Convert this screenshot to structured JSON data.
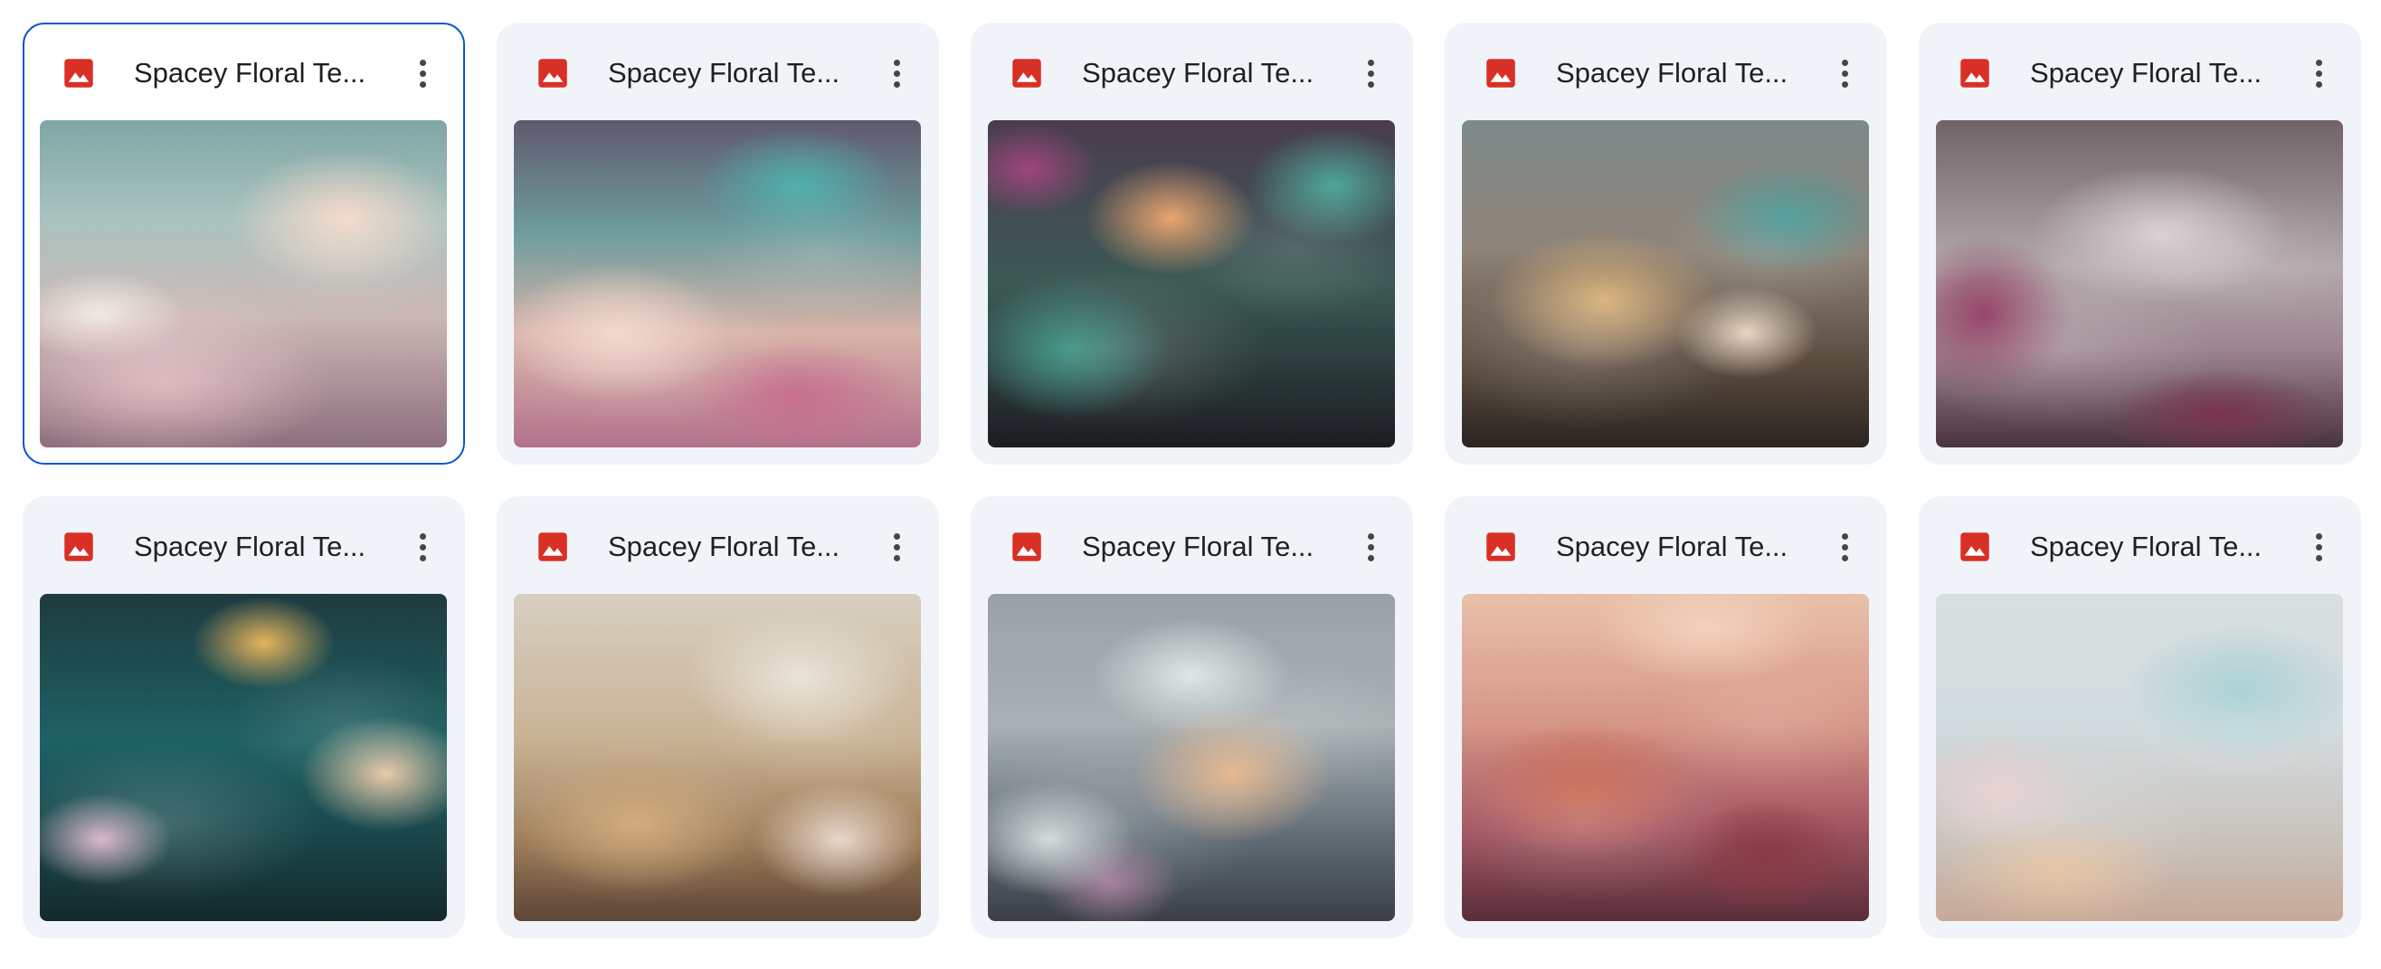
{
  "files": [
    {
      "title": "Spacey Floral Te...",
      "file_type_icon": "image-file-icon",
      "selected": true
    },
    {
      "title": "Spacey Floral Te...",
      "file_type_icon": "image-file-icon",
      "selected": false
    },
    {
      "title": "Spacey Floral Te...",
      "file_type_icon": "image-file-icon",
      "selected": false
    },
    {
      "title": "Spacey Floral Te...",
      "file_type_icon": "image-file-icon",
      "selected": false
    },
    {
      "title": "Spacey Floral Te...",
      "file_type_icon": "image-file-icon",
      "selected": false
    },
    {
      "title": "Spacey Floral Te...",
      "file_type_icon": "image-file-icon",
      "selected": false
    },
    {
      "title": "Spacey Floral Te...",
      "file_type_icon": "image-file-icon",
      "selected": false
    },
    {
      "title": "Spacey Floral Te...",
      "file_type_icon": "image-file-icon",
      "selected": false
    },
    {
      "title": "Spacey Floral Te...",
      "file_type_icon": "image-file-icon",
      "selected": false
    },
    {
      "title": "Spacey Floral Te...",
      "file_type_icon": "image-file-icon",
      "selected": false
    }
  ],
  "more_actions_icon": "more-vert-icon",
  "colors": {
    "image_icon": "#d93025",
    "card_background": "#f0f4f9",
    "selected_border": "#0b57d0",
    "title_text": "#1f1f1f"
  }
}
